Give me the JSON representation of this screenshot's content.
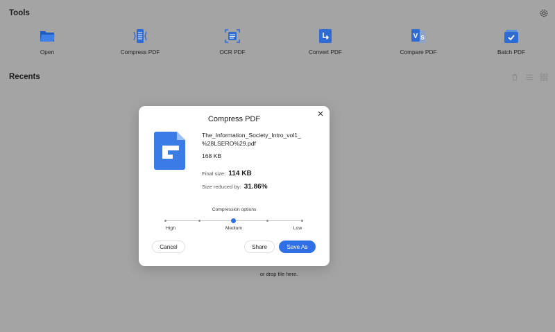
{
  "header": {
    "tools_title": "Tools",
    "recents_title": "Recents"
  },
  "tools": [
    {
      "label": "Open",
      "icon": "open-folder-icon"
    },
    {
      "label": "Compress PDF",
      "icon": "compress-pdf-icon"
    },
    {
      "label": "OCR PDF",
      "icon": "ocr-pdf-icon"
    },
    {
      "label": "Convert PDF",
      "icon": "convert-pdf-icon"
    },
    {
      "label": "Compare PDF",
      "icon": "compare-pdf-icon"
    },
    {
      "label": "Batch PDF",
      "icon": "batch-pdf-icon"
    }
  ],
  "recents": {
    "drop_text": "or drop file here."
  },
  "dialog": {
    "title": "Compress PDF",
    "file_name": "The_Information_Society_Intro_vol1_\n%28LSERO%29.pdf",
    "file_size": "168 KB",
    "final_size_label": "Final size:",
    "final_size_value": "114 KB",
    "reduced_label": "Size reduced by:",
    "reduced_value": "31.86%",
    "options_title": "Compression options",
    "slider": {
      "labels": [
        "High",
        "Medium",
        "Low"
      ],
      "selected": "Medium",
      "steps": 5,
      "selected_step": 2
    },
    "cancel_label": "Cancel",
    "share_label": "Share",
    "save_as_label": "Save As"
  },
  "colors": {
    "accent": "#2f6fe6",
    "overlay": "#a4a4a4",
    "icon_blue": "#2e6bd3"
  }
}
